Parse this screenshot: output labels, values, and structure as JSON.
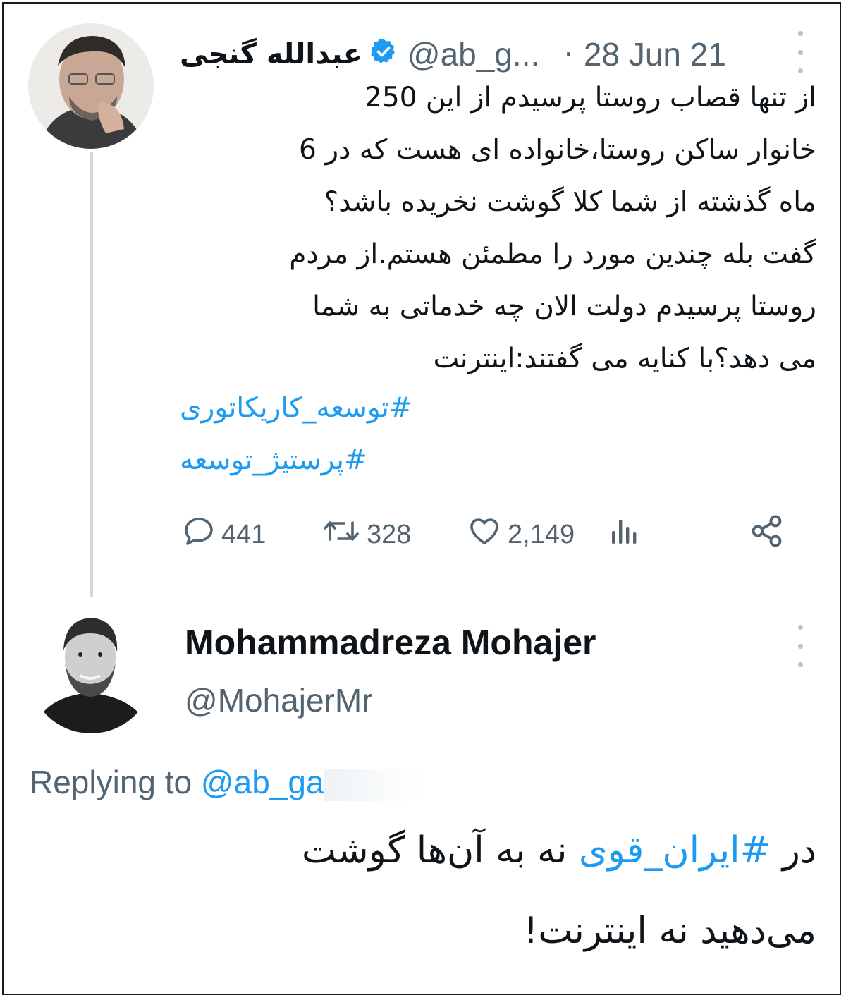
{
  "tweet": {
    "display_name": "عبدالله گنجی",
    "handle": "@ab_g...",
    "date_separator": "·",
    "date": "28 Jun 21",
    "lines": [
      "از تنها قصاب روستا پرسیدم از این 250",
      "خانوار ساکن روستا،خانواده ای هست که در 6",
      "ماه گذشته از شما کلا گوشت نخریده باشد؟",
      "گفت بله چندین مورد را مطمئن هستم.از مردم",
      "روستا پرسیدم دولت الان چه خدماتی به شما",
      "می دهد؟با کنایه می گفتند:اینترنت"
    ],
    "hashtags": [
      "#توسعه_کاریکاتوری",
      "#پرستیژ_توسعه"
    ],
    "stats": {
      "replies": "441",
      "retweets": "328",
      "likes": "2,149"
    }
  },
  "reply": {
    "display_name": "Mohammadreza Mohajer",
    "handle": "@MohajerMr",
    "replying_label": "Replying to",
    "replying_handle": "@ab_ga",
    "line1_pre": "در ",
    "line1_hashtag": "#ایران_قوی",
    "line1_post": " نه به آن‌ها گوشت",
    "line2": "می‌دهید نه اینترنت!"
  },
  "colors": {
    "accent": "#1d9bf0",
    "muted": "#536471",
    "text": "#0f1419",
    "thread_line": "#cfd9de"
  },
  "icons": [
    "verified-badge-icon",
    "more-icon",
    "reply-icon",
    "retweet-icon",
    "like-icon",
    "views-icon",
    "share-icon"
  ]
}
